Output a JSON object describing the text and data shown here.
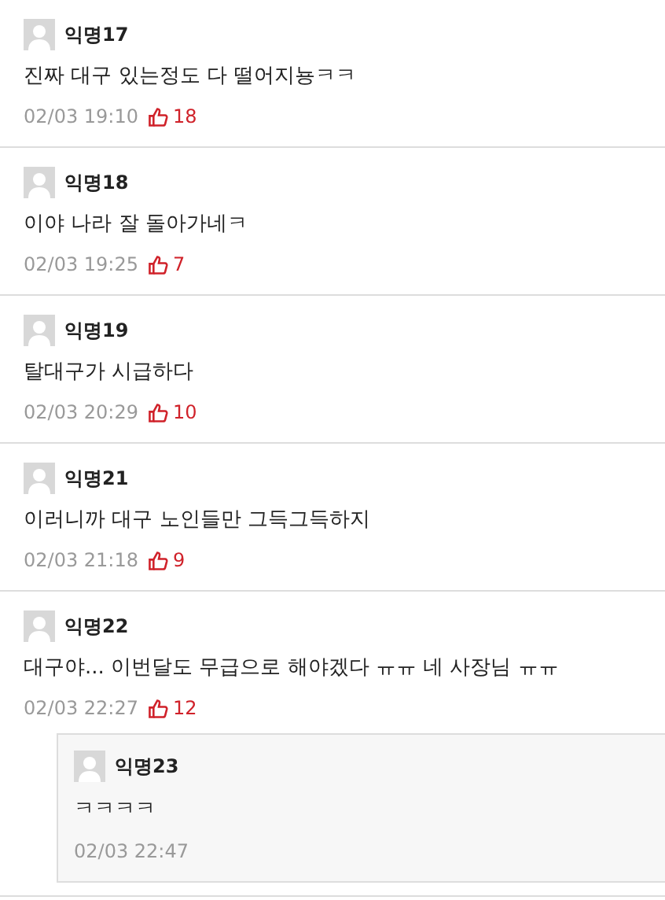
{
  "comments": [
    {
      "author": "익명17",
      "text": "진짜 대구 있는정도 다 떨어지뇽ㅋㅋ",
      "time": "02/03 19:10",
      "likes": "18"
    },
    {
      "author": "익명18",
      "text": "이야 나라 잘 돌아가네ㅋ",
      "time": "02/03 19:25",
      "likes": "7"
    },
    {
      "author": "익명19",
      "text": "탈대구가 시급하다",
      "time": "02/03 20:29",
      "likes": "10"
    },
    {
      "author": "익명21",
      "text": "이러니까 대구 노인들만 그득그득하지",
      "time": "02/03 21:18",
      "likes": "9"
    },
    {
      "author": "익명22",
      "text": "대구야... 이번달도 무급으로 해야겠다 ㅠㅠ 네 사장님 ㅠㅠ",
      "time": "02/03 22:27",
      "likes": "12",
      "children": [
        {
          "author": "익명23",
          "text": "ㅋㅋㅋㅋ",
          "time": "02/03 22:47"
        }
      ]
    }
  ]
}
